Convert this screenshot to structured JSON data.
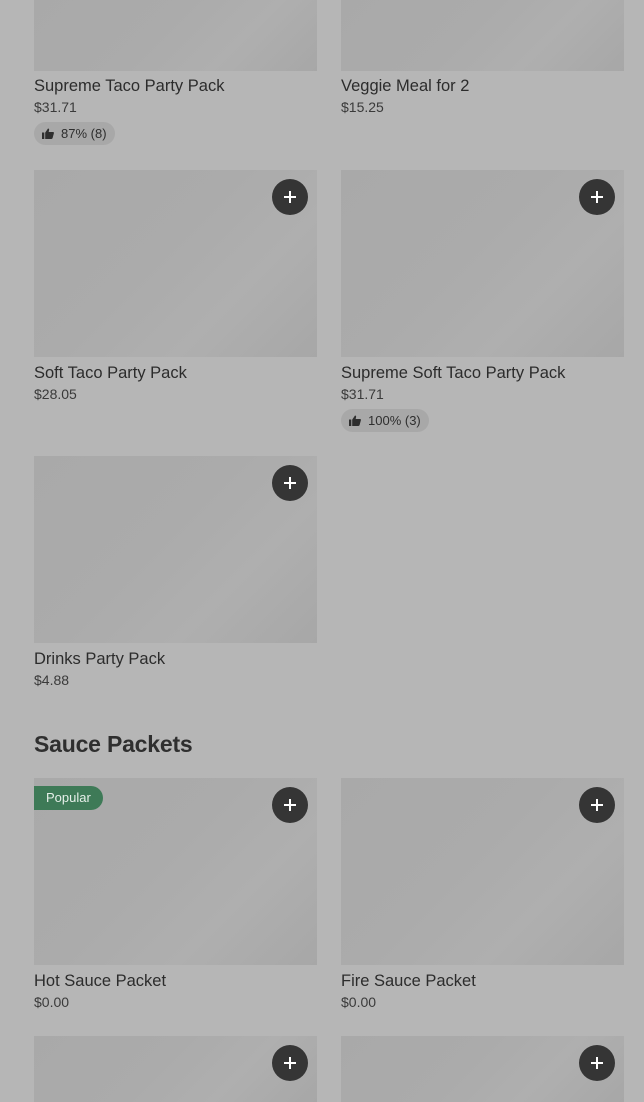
{
  "top_items": [
    {
      "name": "Supreme Taco Party Pack",
      "price": "$31.71",
      "rating": "87% (8)"
    },
    {
      "name": "Veggie Meal for 2",
      "price": "$15.25"
    }
  ],
  "party_items": [
    {
      "name": "Soft Taco Party Pack",
      "price": "$28.05"
    },
    {
      "name": "Supreme Soft Taco Party Pack",
      "price": "$31.71",
      "rating": "100% (3)"
    },
    {
      "name": "Drinks Party Pack",
      "price": "$4.88"
    }
  ],
  "sauce_section": {
    "title": "Sauce Packets",
    "badge": "Popular",
    "items": [
      {
        "name": "Hot Sauce Packet",
        "price": "$0.00"
      },
      {
        "name": "Fire Sauce Packet",
        "price": "$0.00"
      }
    ]
  },
  "icons": {
    "add": "plus-icon",
    "rating": "thumbs-up-icon"
  },
  "colors": {
    "overlay_background": "#b6b6b6",
    "add_button": "#353535",
    "popular_badge": "#3e7a57"
  }
}
